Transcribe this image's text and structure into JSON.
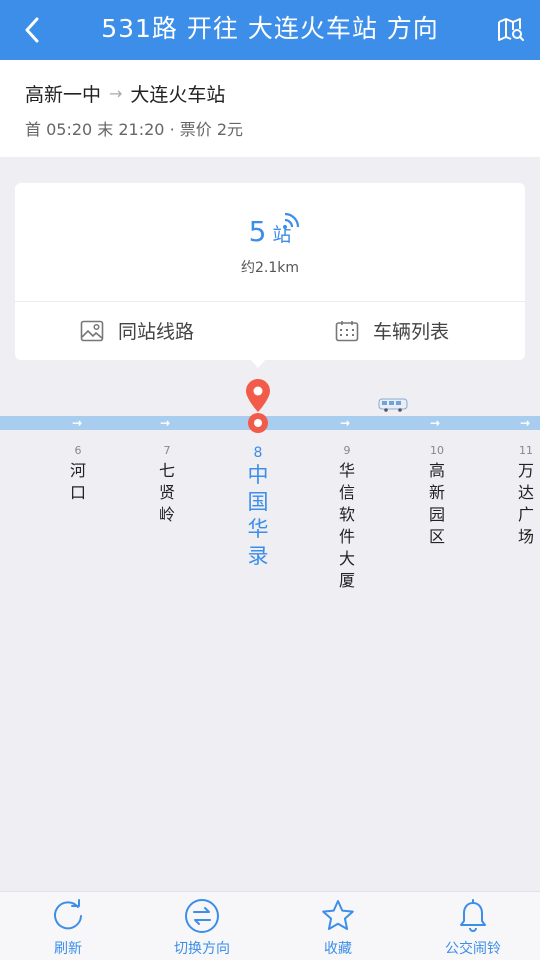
{
  "header": {
    "title": "531路 开往 大连火车站 方向"
  },
  "route": {
    "from": "高新一中",
    "arrow": "→",
    "to": "大连火车站",
    "schedule": "首 05:20 末 21:20 · 票价 2元"
  },
  "card": {
    "stops_count": "5",
    "stops_unit": "站",
    "distance": "约2.1km",
    "action_same_station": "同站线路",
    "action_vehicle_list": "车辆列表"
  },
  "stations": [
    {
      "index": "6",
      "name": "河口"
    },
    {
      "index": "7",
      "name": "七贤岭"
    },
    {
      "index": "8",
      "name": "中国华录"
    },
    {
      "index": "9",
      "name": "华信软件大厦"
    },
    {
      "index": "10",
      "name": "高新园区"
    },
    {
      "index": "11",
      "name": "万达广场"
    }
  ],
  "bottom": {
    "refresh": "刷新",
    "switch_direction": "切换方向",
    "favorite": "收藏",
    "bus_alarm": "公交闹铃"
  },
  "colors": {
    "primary": "#3d8ee8",
    "accent": "#f25b49",
    "track": "#a9cdef"
  }
}
